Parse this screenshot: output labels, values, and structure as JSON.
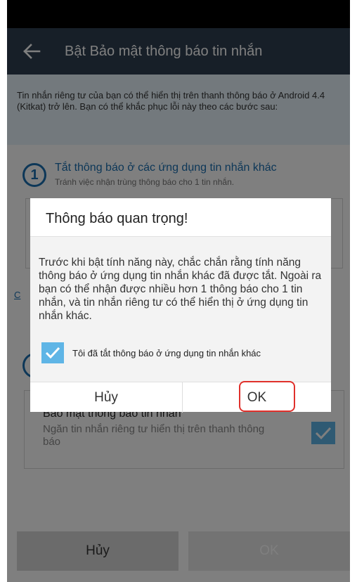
{
  "app_bar": {
    "title": "Bật Bảo mật thông báo tin nhắn",
    "back_icon": "arrow-left-icon"
  },
  "info": {
    "text": "Tin nhắn riêng tư của bạn có thể hiển thị trên thanh thông báo ở Android 4.4 (Kitkat) trở lên. Bạn có thể khắc phục lỗi này theo các bước sau:"
  },
  "step1": {
    "number": "1",
    "title": "Tắt thông báo ở các ứng dụng tin nhắn khác",
    "subtitle": "Tránh việc nhận trùng thông báo cho 1 tin nhắn."
  },
  "link_partial": "C",
  "box2": {
    "title": "Bảo mật thông báo tin nhắn",
    "desc": "Ngăn tin nhắn riêng tư hiển thị trên thanh thông báo",
    "checked": true
  },
  "bottom": {
    "cancel": "Hủy",
    "ok": "OK"
  },
  "dialog": {
    "title": "Thông báo quan trọng!",
    "message": "Trước khi bật tính năng này, chắc chắn rằng tính năng thông báo ở ứng dụng tin nhắn khác đã được tắt. Ngoài ra bạn có thể nhận được nhiều hơn 1 thông báo cho 1 tin nhắn, và tin nhắn riêng tư có thể hiển thị ở ứng dụng tin nhắn khác.",
    "checkbox_label": "Tôi đã tắt thông báo ở ứng dụng tin nhắn khác",
    "checkbox_checked": true,
    "cancel": "Hủy",
    "ok": "OK"
  },
  "colors": {
    "app_bar": "#2e3e50",
    "accent": "#1a6fb0",
    "check": "#5fb5e6",
    "highlight": "#e0302b"
  }
}
